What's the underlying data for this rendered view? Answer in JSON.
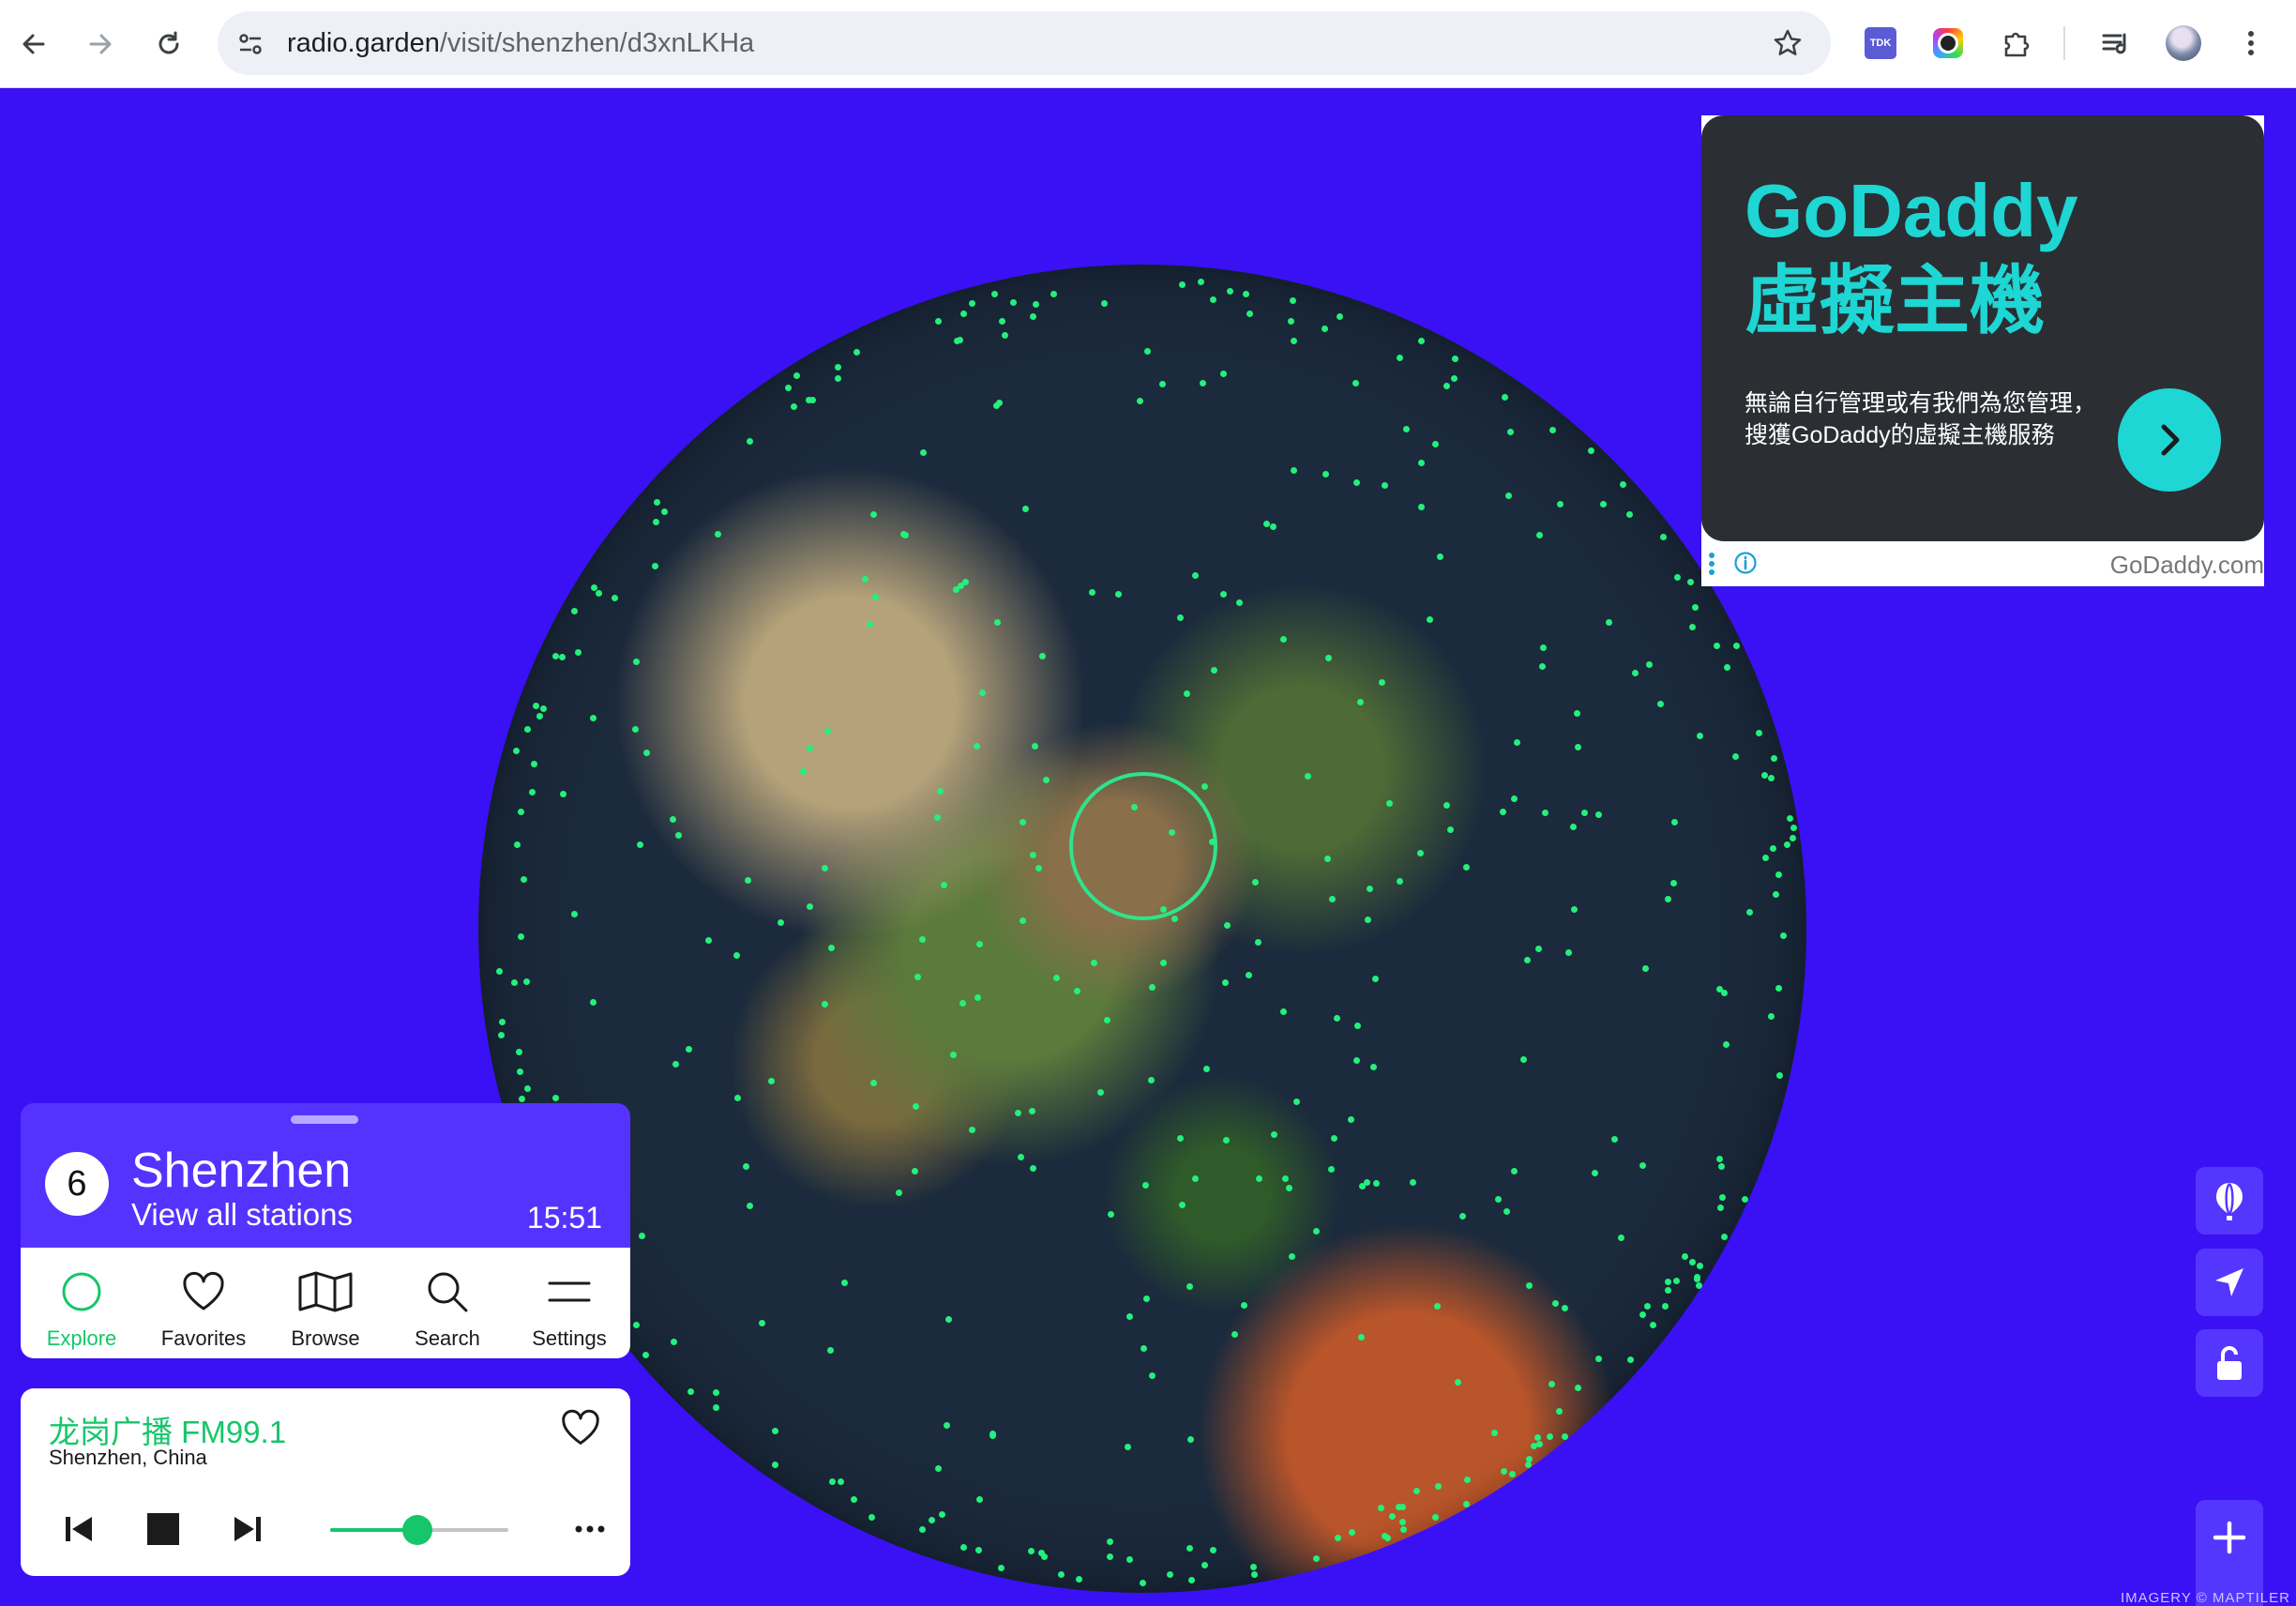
{
  "browser": {
    "url_host": "radio.garden",
    "url_path": "/visit/shenzhen/d3xnLKHa",
    "extensions": [
      "tdk-extension-icon",
      "color-picker-extension-icon",
      "puzzle-extensions-icon",
      "media-queue-icon"
    ],
    "tdk_label": "TDK"
  },
  "ad": {
    "headline": "GoDaddy\n虛擬主機",
    "body": "無論自行管理或有我們為您管理，搜獲GoDaddy的虛擬主機服務",
    "brand": "GoDaddy.com",
    "accent": "#1ed6d3"
  },
  "location": {
    "count": "6",
    "city": "Shenzhen",
    "view_all": "View all stations",
    "time": "15:51"
  },
  "tabs": [
    {
      "label": "Explore",
      "icon": "explore-ring-icon",
      "active": true
    },
    {
      "label": "Favorites",
      "icon": "heart-icon",
      "active": false
    },
    {
      "label": "Browse",
      "icon": "map-icon",
      "active": false
    },
    {
      "label": "Search",
      "icon": "search-icon",
      "active": false
    },
    {
      "label": "Settings",
      "icon": "menu-icon",
      "active": false
    }
  ],
  "player": {
    "station": "龙岗广播 FM99.1",
    "place": "Shenzhen, China",
    "volume": 0.49
  },
  "map": {
    "attribution": "IMAGERY © MAPTILER",
    "background": "#3a10f5",
    "accent": "#16c66a"
  }
}
